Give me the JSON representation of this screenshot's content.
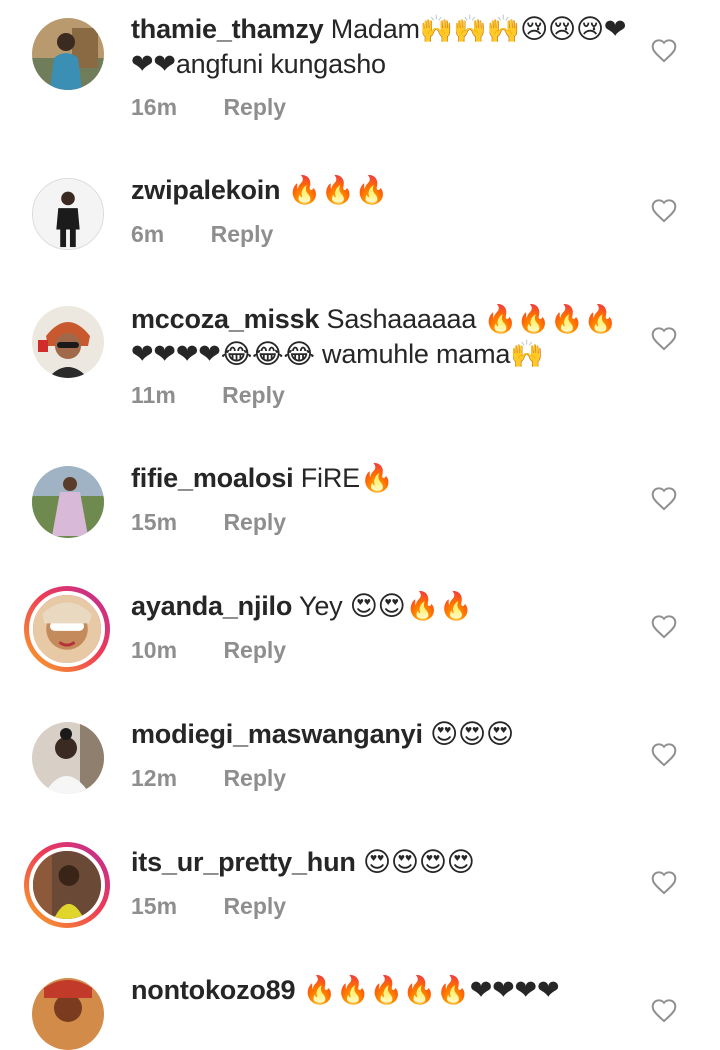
{
  "comments": [
    {
      "username": "thamie_thamzy",
      "text": "Madam🙌🙌🙌😢😢😢❤❤❤angfuni kungasho",
      "time": "16m",
      "reply": "Reply",
      "avatar_colors": [
        "#c9a676",
        "#6f7d5a"
      ],
      "has_story_ring": false
    },
    {
      "username": "zwipalekoin",
      "text": "🔥🔥🔥",
      "time": "6m",
      "reply": "Reply",
      "avatar_colors": [
        "#f2f2f2",
        "#1b1b1b"
      ],
      "has_story_ring": false
    },
    {
      "username": "mccoza_missk",
      "text": "Sashaaaaaa 🔥🔥🔥🔥❤❤❤❤😂😂😂 wamuhle mama🙌",
      "time": "11m",
      "reply": "Reply",
      "avatar_colors": [
        "#e7e2da",
        "#c8582d"
      ],
      "has_story_ring": false
    },
    {
      "username": "fifie_moalosi",
      "text": "FiRE🔥",
      "time": "15m",
      "reply": "Reply",
      "avatar_colors": [
        "#7c8f5a",
        "#d9b9d8"
      ],
      "has_story_ring": false
    },
    {
      "username": "ayanda_njilo",
      "text": "Yey 😍😍🔥🔥",
      "time": "10m",
      "reply": "Reply",
      "avatar_colors": [
        "#e6b48a",
        "#8b5a3c"
      ],
      "has_story_ring": true
    },
    {
      "username": "modiegi_maswanganyi",
      "text": "😍😍😍",
      "time": "12m",
      "reply": "Reply",
      "avatar_colors": [
        "#cfc7be",
        "#2a2522"
      ],
      "has_story_ring": false
    },
    {
      "username": "its_ur_pretty_hun",
      "text": "😍😍😍😍",
      "time": "15m",
      "reply": "Reply",
      "avatar_colors": [
        "#8c5a3a",
        "#e0d52a"
      ],
      "has_story_ring": true
    },
    {
      "username": "nontokozo89",
      "text": "🔥🔥🔥🔥🔥❤❤❤❤",
      "time": "",
      "reply": "",
      "avatar_colors": [
        "#d38b4a",
        "#7a3b1f"
      ],
      "has_story_ring": false
    }
  ],
  "icons": {
    "like": "heart-outline-icon"
  },
  "colors": {
    "username": "#262626",
    "meta": "#8e8e8e",
    "heart_outline": "#8e8e8e",
    "story_ring": [
      "#f9a825",
      "#ee3b57",
      "#b82c9c"
    ]
  }
}
